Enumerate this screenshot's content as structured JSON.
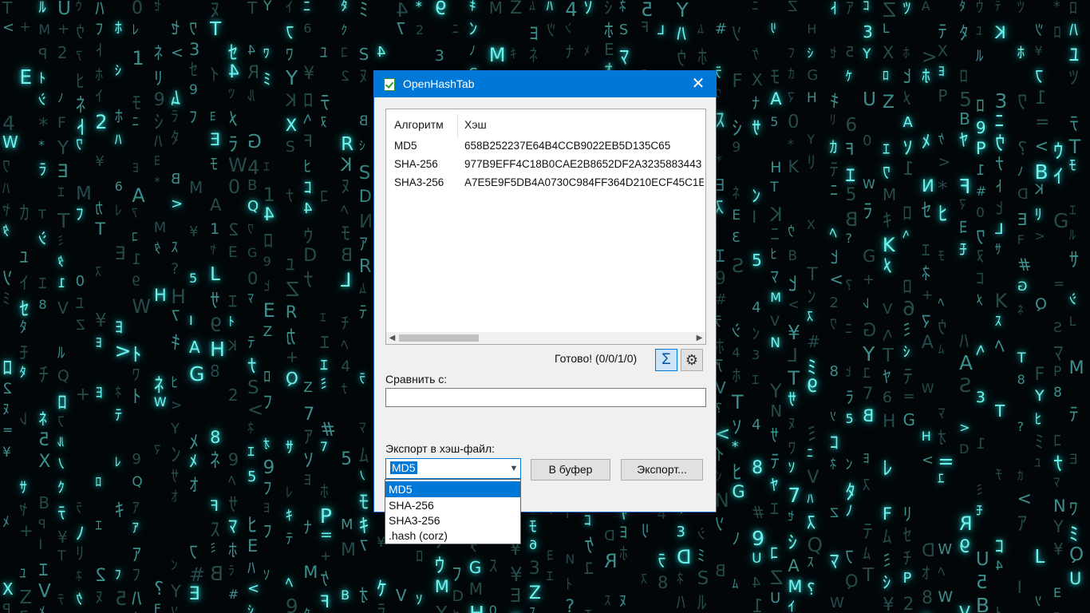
{
  "window": {
    "title": "OpenHashTab"
  },
  "listview": {
    "columns": {
      "algorithm": "Алгоритм",
      "hash": "Хэш"
    },
    "rows": [
      {
        "algorithm": "MD5",
        "hash": "658B252237E64B4CCB9022EB5D135C65"
      },
      {
        "algorithm": "SHA-256",
        "hash": "977B9EFF4C18B0CAE2B8652DF2A3235883443"
      },
      {
        "algorithm": "SHA3-256",
        "hash": "A7E5E9F5DB4A0730C984FF364D210ECF45C1E"
      }
    ]
  },
  "status": {
    "text": "Готово! (0/0/1/0)",
    "sum_icon": "Σ",
    "gear_icon": "⚙"
  },
  "compare": {
    "label": "Сравнить с:",
    "value": ""
  },
  "export": {
    "label": "Экспорт в хэш-файл:",
    "selected": "MD5",
    "clipboard_label": "В буфер",
    "export_label": "Экспорт...",
    "options": [
      "MD5",
      "SHA-256",
      "SHA3-256",
      ".hash (corz)"
    ]
  },
  "colors": {
    "titlebar": "#0078d7",
    "matrix_glow": "#6ff3ee",
    "background": "#020608"
  }
}
